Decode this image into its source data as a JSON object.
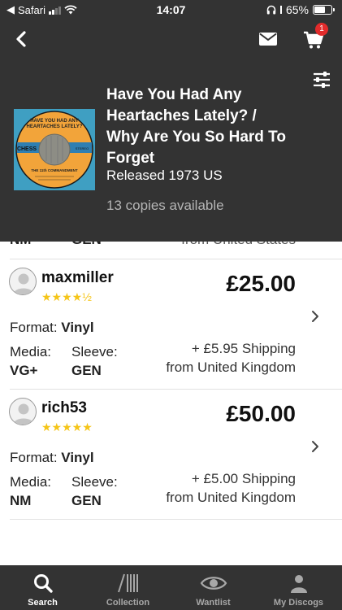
{
  "status_bar": {
    "carrier": "Safari",
    "time": "14:07",
    "battery": "65%"
  },
  "header": {
    "cart_count": "1",
    "title": "Have You Had Any Heartaches Lately? / Why Are You So Hard To Forget",
    "released": "Released 1973 US",
    "copies": "13 copies available",
    "cover_label": {
      "line1": "HAVE YOU HAD ANY",
      "line2": "HEARTACHES LATELY?",
      "brand": "CHESS",
      "stereo": "STEREO",
      "artist": "THE 11th COMMANDMENT"
    }
  },
  "partial_row": {
    "media": "NM",
    "sleeve": "GEN",
    "origin": "from United States"
  },
  "listings": [
    {
      "seller": "maxmiller",
      "stars": "★★★★½",
      "price": "£25.00",
      "format_label": "Format:",
      "format_value": "Vinyl",
      "media_label": "Media:",
      "media_value": "VG+",
      "sleeve_label": "Sleeve:",
      "sleeve_value": "GEN",
      "shipping": "+ £5.95 Shipping",
      "origin": "from United Kingdom"
    },
    {
      "seller": "rich53",
      "stars": "★★★★★",
      "price": "£50.00",
      "format_label": "Format:",
      "format_value": "Vinyl",
      "media_label": "Media:",
      "media_value": "NM",
      "sleeve_label": "Sleeve:",
      "sleeve_value": "GEN",
      "shipping": "+ £5.00 Shipping",
      "origin": "from United Kingdom"
    }
  ],
  "tabs": [
    {
      "label": "Search",
      "icon": "search-icon",
      "active": true
    },
    {
      "label": "Collection",
      "icon": "collection-icon",
      "active": false
    },
    {
      "label": "Wantlist",
      "icon": "eye-icon",
      "active": false
    },
    {
      "label": "My Discogs",
      "icon": "user-icon",
      "active": false
    }
  ],
  "colors": {
    "header_bg": "#333333",
    "badge": "#e22b2b",
    "stars": "#f5c518"
  }
}
